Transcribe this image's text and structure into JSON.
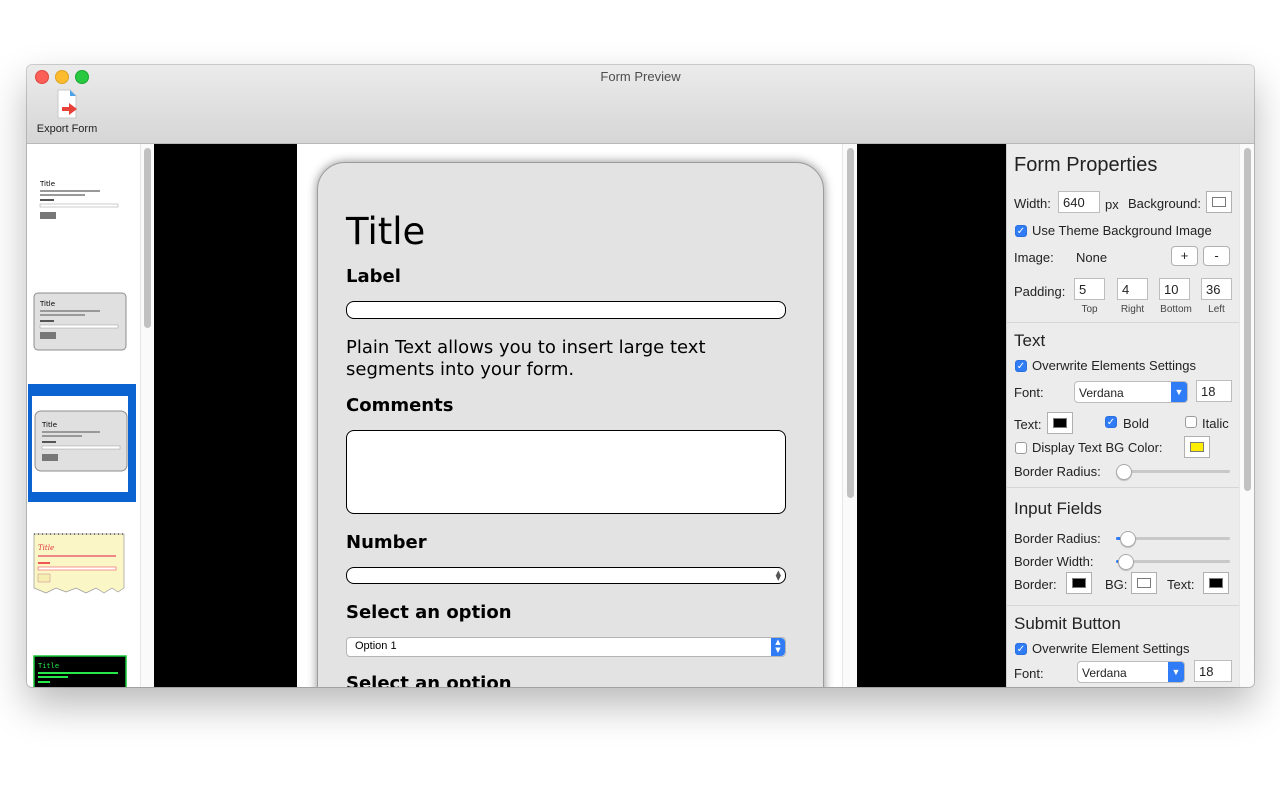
{
  "window": {
    "title": "Form Preview"
  },
  "toolbar": {
    "export_label": "Export Form"
  },
  "form_preview": {
    "title": "Title",
    "label1": "Label",
    "plain_text": "Plain Text allows you to insert large text segments into your form.",
    "comments_label": "Comments",
    "number_label": "Number",
    "select_label": "Select an option",
    "select_value": "Option 1",
    "select_label_2": "Select an option"
  },
  "themes": [
    {
      "name": "plain"
    },
    {
      "name": "gray-card"
    },
    {
      "name": "gray-card-selected"
    },
    {
      "name": "notebook"
    },
    {
      "name": "terminal-green"
    }
  ],
  "properties": {
    "header": "Form Properties",
    "width_label": "Width:",
    "width_value": "640",
    "width_unit": "px",
    "background_label": "Background:",
    "use_theme_bg": "Use Theme Background Image",
    "image_label": "Image:",
    "image_value": "None",
    "add_label": "+",
    "remove_label": "-",
    "padding_label": "Padding:",
    "padding": {
      "top": "5",
      "right": "4",
      "bottom": "10",
      "left": "36"
    },
    "padding_captions": {
      "top": "Top",
      "right": "Right",
      "bottom": "Bottom",
      "left": "Left"
    }
  },
  "text_section": {
    "header": "Text",
    "overwrite": "Overwrite Elements Settings",
    "font_label": "Font:",
    "font_value": "Verdana",
    "font_size": "18",
    "text_color_label": "Text:",
    "bold_label": "Bold",
    "italic_label": "Italic",
    "display_bg_label": "Display Text BG Color:",
    "border_radius_label": "Border Radius:",
    "text_color": "#000000",
    "bg_color": "#ffee00",
    "border_radius_fraction": 0.0
  },
  "input_fields": {
    "header": "Input Fields",
    "border_radius_label": "Border Radius:",
    "border_width_label": "Border Width:",
    "border_label": "Border:",
    "bg_label": "BG:",
    "text_label": "Text:",
    "border_radius_fraction": 0.1,
    "border_width_fraction": 0.08,
    "border_color": "#000000",
    "bg_color": "#ffffff",
    "text_color": "#000000"
  },
  "submit_button": {
    "header": "Submit Button",
    "overwrite": "Overwrite Element Settings",
    "font_label": "Font:",
    "font_value": "Verdana",
    "font_size": "18"
  },
  "colors": {
    "accent": "#2f7cf6",
    "selection": "#0a63d1"
  }
}
